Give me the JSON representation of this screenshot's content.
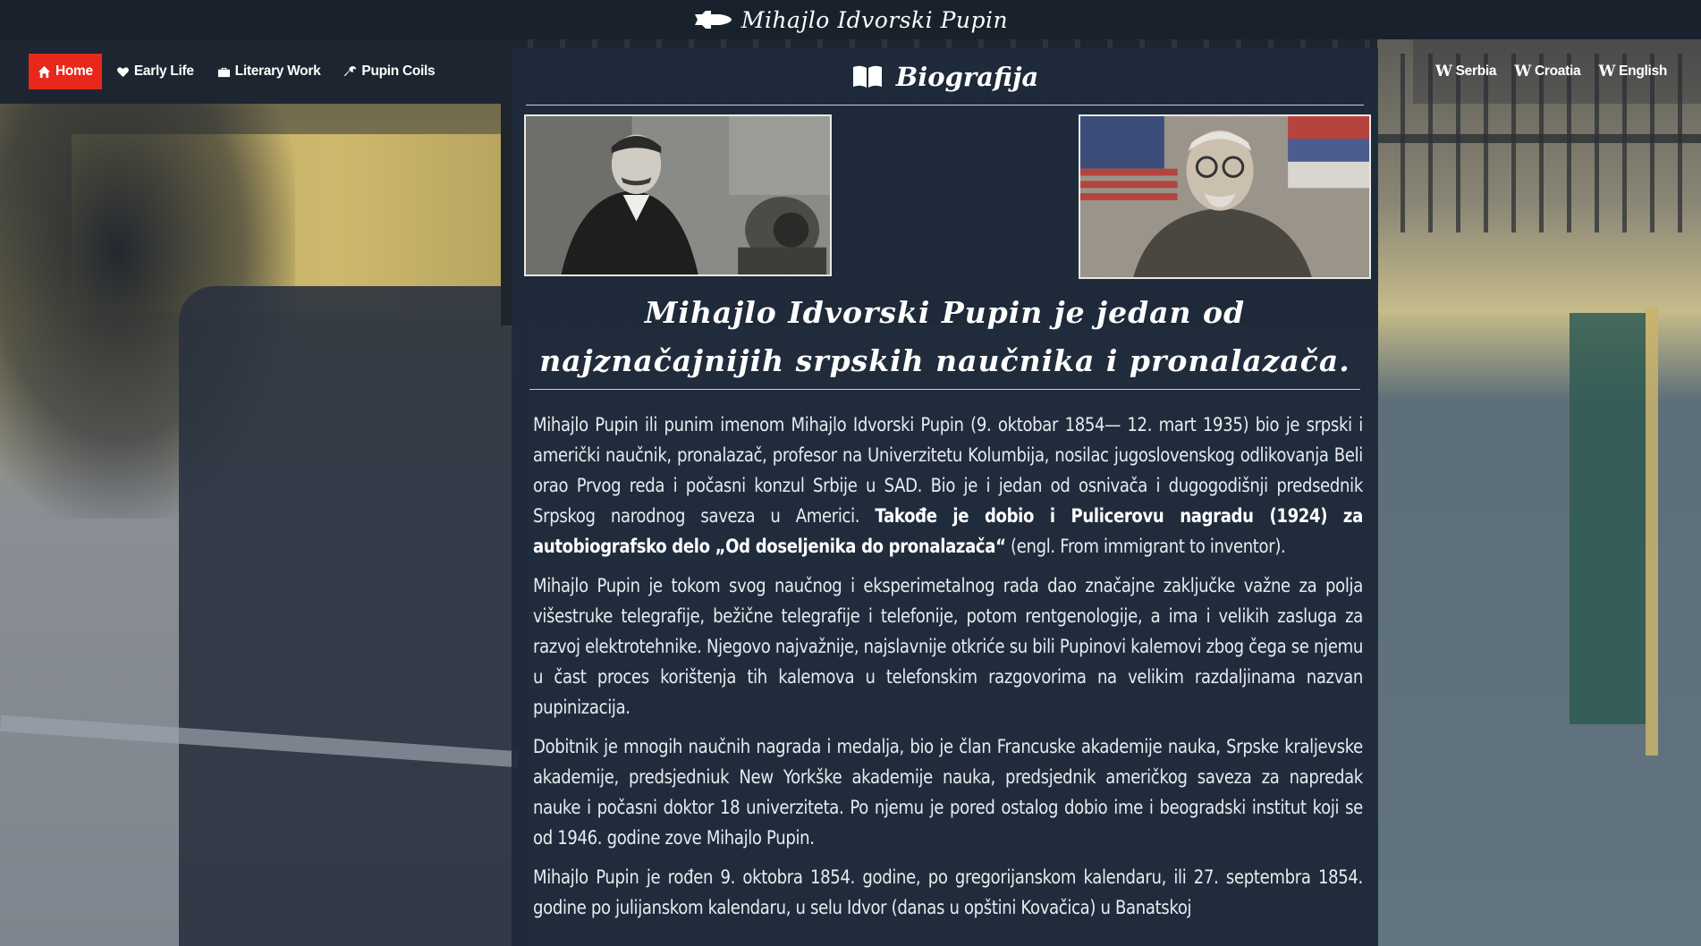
{
  "site": {
    "title": "Mihajlo Idvorski Pupin",
    "logo_icon": "space-shuttle-icon"
  },
  "nav": {
    "items": [
      {
        "label": "Home",
        "icon": "home-icon",
        "active": true
      },
      {
        "label": "Early Life",
        "icon": "heart-icon",
        "active": false
      },
      {
        "label": "Literary Work",
        "icon": "briefcase-icon",
        "active": false
      },
      {
        "label": "Pupin Coils",
        "icon": "wrench-icon",
        "active": false
      }
    ],
    "active_color": "#e8281a"
  },
  "languages": [
    {
      "label": "Serbia",
      "icon": "wikipedia-icon"
    },
    {
      "label": "Croatia",
      "icon": "wikipedia-icon"
    },
    {
      "label": "English",
      "icon": "wikipedia-icon"
    }
  ],
  "panel": {
    "title": "Biografija",
    "title_icon": "book-icon",
    "headline": "Mihajlo Idvorski Pupin je jedan od najznačajnijih srpskih naučnika i pronalazača.",
    "paragraphs": [
      {
        "before": "Mihajlo Pupin ili punim imenom Mihajlo Idvorski Pupin (9. oktobar 1854— 12. mart 1935) bio je srpski i američki naučnik, pronalazač, profesor na Univerzitetu Kolumbija, nosilac jugoslovenskog odlikovanja Beli orao Prvog reda i počasni konzul Srbije u SAD. Bio je i jedan od osnivača i dugogodišnji predsednik Srpskog narodnog saveza u Americi. ",
        "bold": "Takođe je dobio i Pulicerovu nagradu (1924) za autobiografsko delo „Od doseljenika do pronalazača“",
        "after": " (engl. From immigrant to inventor)."
      },
      {
        "before": "Mihajlo Pupin je tokom svog naučnog i eksperimetalnog rada dao značajne zaključke važne za polja višestruke telegrafije, bežične telegrafije i telefonije, potom rentgenologije, a ima i velikih zasluga za razvoj elektrotehnike. Njegovo najvažnije, najslavnije otkriće su bili Pupinovi kalemovi zbog čega se njemu u čast proces korištenja tih kalemova u telefonskim razgovorima na velikim razdaljinama nazvan pupinizacija.",
        "bold": "",
        "after": ""
      },
      {
        "before": "Dobitnik je mnogih naučnih nagrada i medalja, bio je član Francuske akademije nauka, Srpske kraljevske akademije, predsjedniuk New Yorkške akademije nauka, predsjednik američkog saveza za napredak nauke i počasni doktor 18 univerziteta. Po njemu je pored ostalog dobio ime i beogradski institut koji se od 1946. godine zove Mihajlo Pupin.",
        "bold": "",
        "after": ""
      },
      {
        "before": "Mihajlo Pupin je rođen 9. oktobra 1854. godine, po gregorijanskom kalendaru, ili 27. septembra 1854. godine po julijanskom kalendaru, u selu Idvor (danas u opštini Kovačica) u Banatskoj",
        "bold": "",
        "after": ""
      }
    ]
  }
}
